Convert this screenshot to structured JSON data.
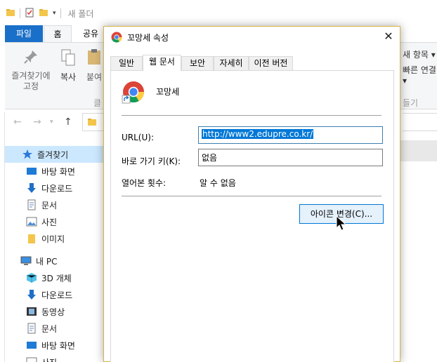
{
  "explorer": {
    "window_title": "새 폴더",
    "ribbon_tabs": [
      "파일",
      "홈",
      "공유"
    ],
    "ribbon": {
      "pin_label_line1": "즐겨찾기에",
      "pin_label_line2": "고정",
      "copy_label": "복사",
      "paste_label": "붙여",
      "clipboard_group_label": "클",
      "right_item1": "새 항목 ▾",
      "right_item2": "빠른 연결 ▾",
      "right_group_label": "들기"
    },
    "nav": {
      "quick_access": "즐겨찾기",
      "items": [
        "바탕 화면",
        "다운로드",
        "문서",
        "사진",
        "이미지"
      ],
      "this_pc": "내 PC",
      "pc_items": [
        "3D 개체",
        "다운로드",
        "동영상",
        "문서",
        "바탕 화면",
        "사진"
      ]
    }
  },
  "dialog": {
    "title": "꼬망세 속성",
    "tabs": [
      "일반",
      "웹 문서",
      "보안",
      "자세히",
      "이전 버전"
    ],
    "active_tab": "웹 문서",
    "item_name": "꼬망세",
    "url_label": "URL(U):",
    "url_value": "http://www2.edupre.co.kr/",
    "shortcut_label": "바로 가기 키(K):",
    "shortcut_value": "없음",
    "visits_label": "열어본 횟수:",
    "visits_value": "알 수 없음",
    "change_icon_button": "아이콘 변경(C)...",
    "close_glyph": "✕"
  },
  "colors": {
    "accent": "#0078d7",
    "file_tab": "#1a6fc9",
    "dialog_border": "#d6b34a",
    "selection_bg": "#cce8ff"
  }
}
